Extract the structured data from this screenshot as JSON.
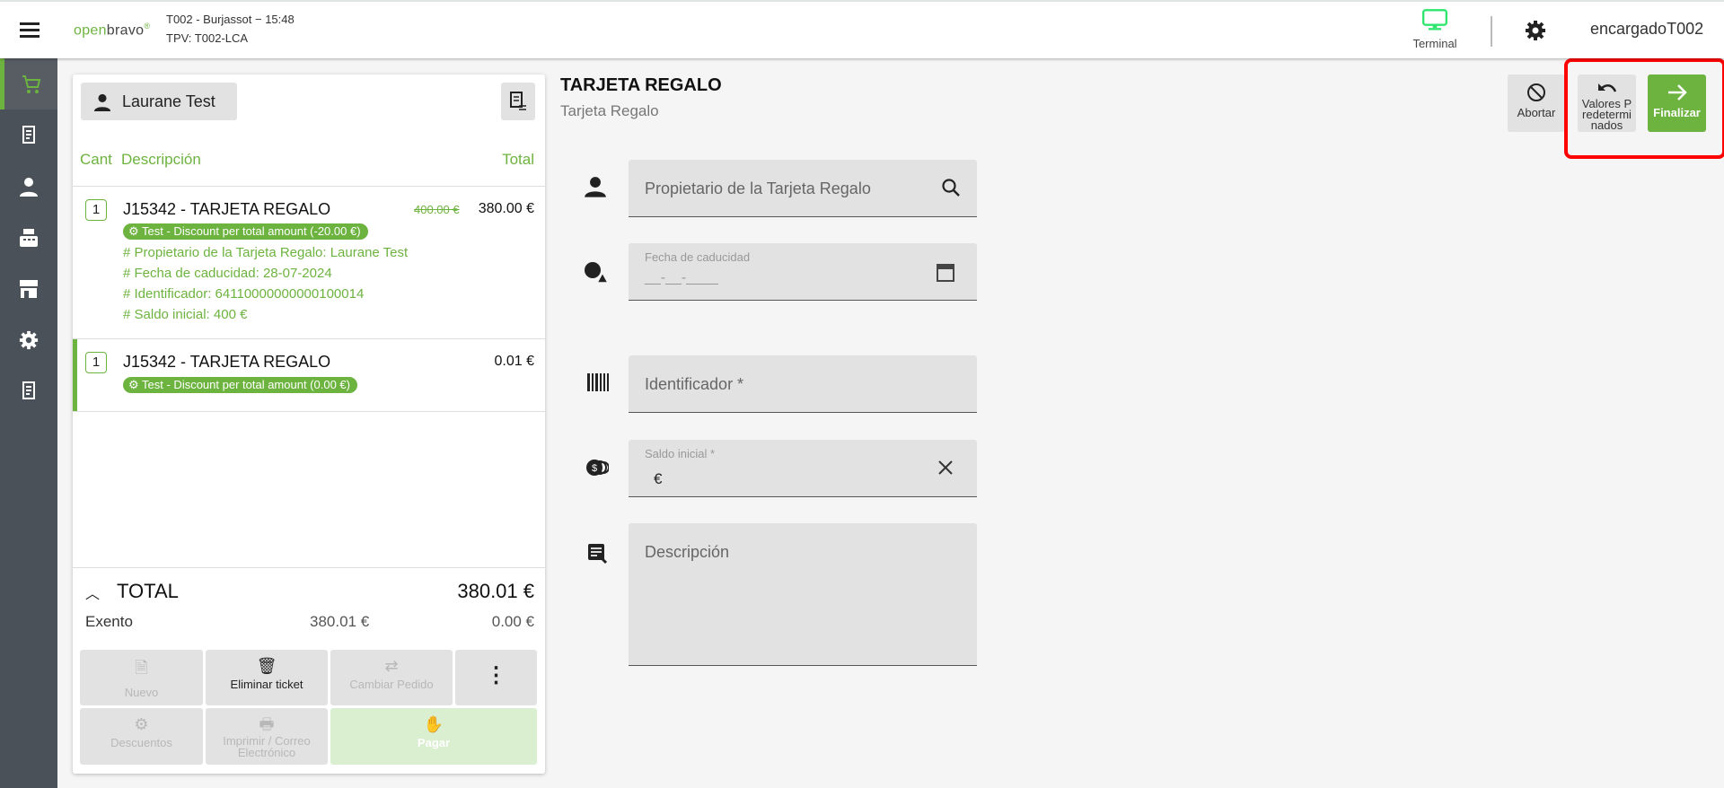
{
  "header": {
    "store_line": "T002 - Burjassot − 15:48",
    "terminal_line": "TPV: T002-LCA",
    "terminal_label": "Terminal",
    "user": "encargadoT002",
    "logo": "openbravo"
  },
  "ticket": {
    "customer": "Laurane Test",
    "columns": {
      "qty": "Cant",
      "description": "Descripción",
      "total": "Total"
    },
    "lines": [
      {
        "qty": "1",
        "name": "J15342 - TARJETA REGALO",
        "old_price": "400.00 €",
        "price": "380.00 €",
        "discount": "Test - Discount per total amount (-20.00 €)",
        "attributes": [
          "# Propietario de la Tarjeta Regalo: Laurane Test",
          "# Fecha de caducidad: 28-07-2024",
          "# Identificador: 64110000000000100014",
          "# Saldo inicial: 400 €"
        ]
      },
      {
        "qty": "1",
        "name": "J15342 - TARJETA REGALO",
        "price": "0.01 €",
        "discount": "Test - Discount per total amount (0.00 €)"
      }
    ],
    "total_label": "TOTAL",
    "total": "380.01 €",
    "tax_name": "Exento",
    "tax_base": "380.01 €",
    "tax_amount": "0.00 €",
    "buttons": {
      "new": "Nuevo",
      "delete": "Eliminar ticket",
      "change": "Cambiar Pedido",
      "discounts": "Descuentos",
      "print": "Imprimir / Correo Electrónico",
      "pay": "Pagar"
    }
  },
  "form": {
    "title": "TARJETA REGALO",
    "subtitle": "Tarjeta Regalo",
    "owner_placeholder": "Propietario de la Tarjeta Regalo",
    "expiry_label": "Fecha de caducidad",
    "expiry_mask": "__-__-____",
    "id_placeholder": "Identificador *",
    "balance_label": "Saldo inicial *",
    "balance_currency": "€",
    "description_placeholder": "Descripción",
    "abort": "Abortar",
    "defaults": "Valores Predeterminados",
    "finish": "Finalizar"
  },
  "colors": {
    "accent": "#6db33f",
    "highlight": "#ff0000"
  }
}
